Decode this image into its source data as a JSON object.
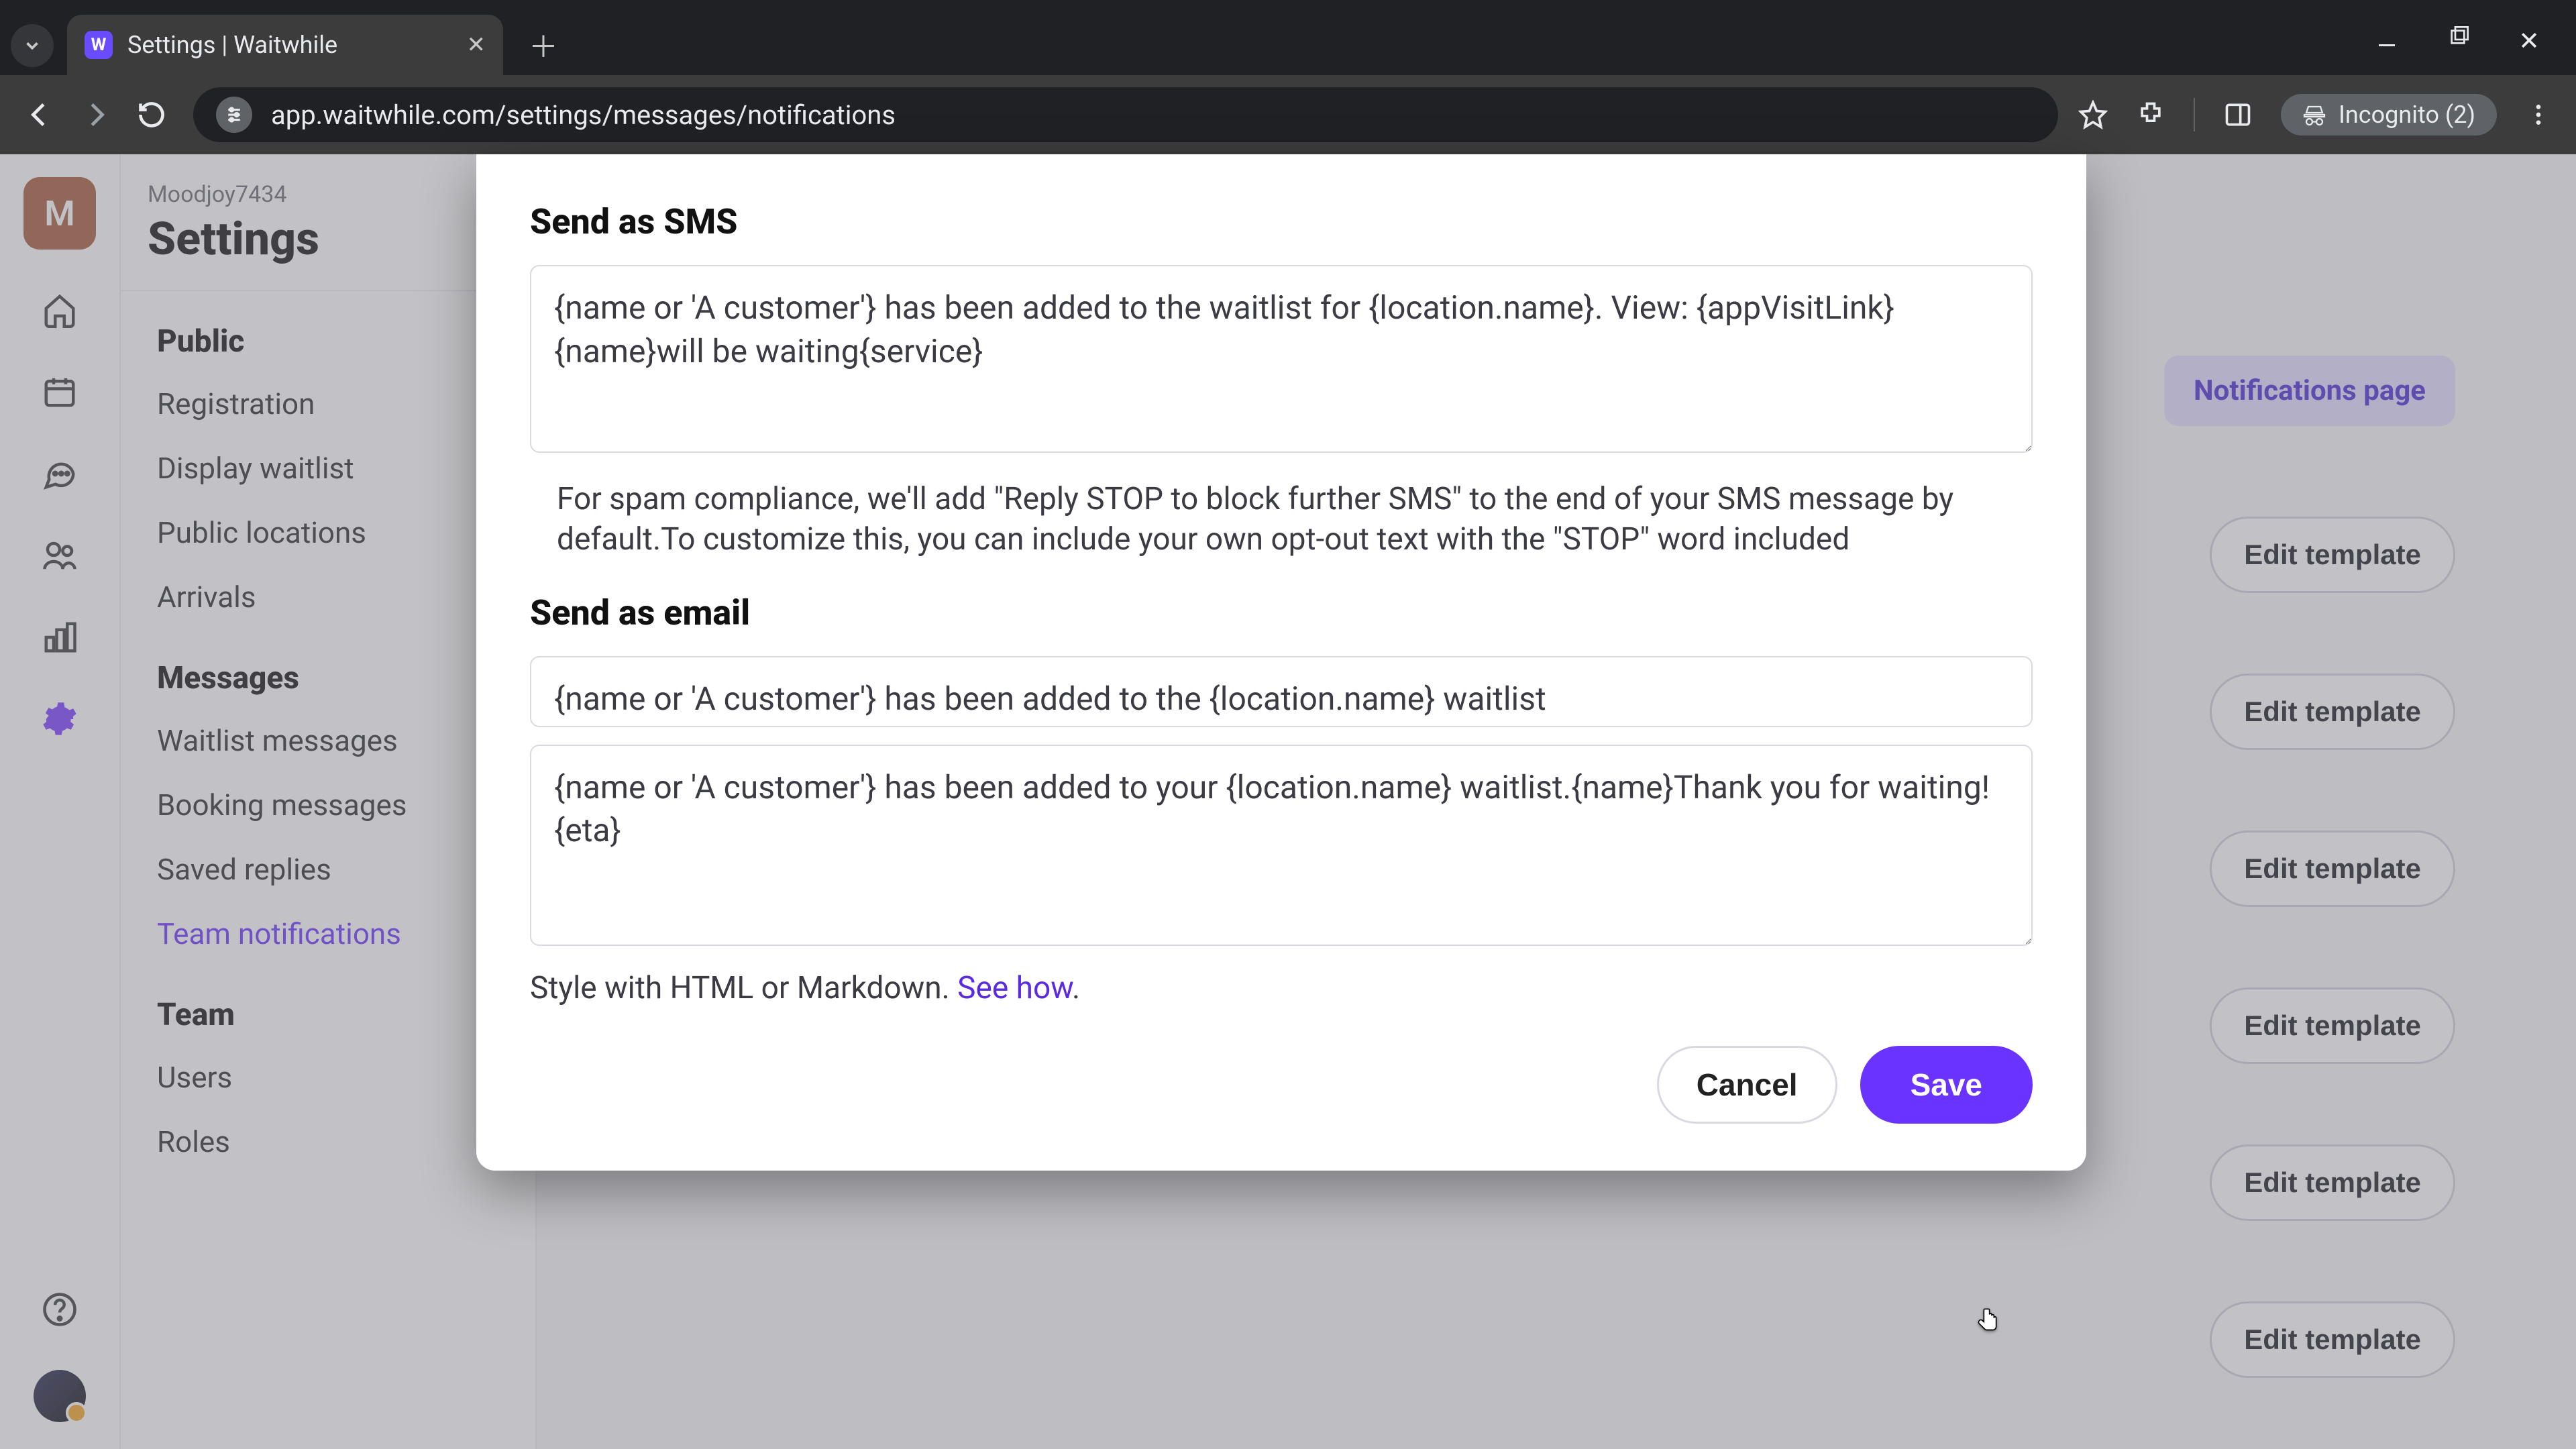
{
  "browser": {
    "tab_title": "Settings | Waitwhile",
    "url": "app.waitwhile.com/settings/messages/notifications",
    "incognito_label": "Incognito (2)"
  },
  "iconbar": {
    "org_initial": "M"
  },
  "settings": {
    "org_name": "Moodjoy7434",
    "title": "Settings",
    "groups": {
      "public": {
        "title": "Public",
        "items": [
          "Registration",
          "Display waitlist",
          "Public locations",
          "Arrivals"
        ]
      },
      "messages": {
        "title": "Messages",
        "items": [
          "Waitlist messages",
          "Booking messages",
          "Saved replies",
          "Team notifications"
        ]
      },
      "team": {
        "title": "Team",
        "items": [
          "Users",
          "Roles"
        ]
      }
    },
    "active_item": "Team notifications"
  },
  "main": {
    "notifications_pill": "Notifications page",
    "edit_template_label": "Edit template"
  },
  "modal": {
    "sms_heading": "Send as SMS",
    "sms_value": "{name or 'A customer'} has been added to the waitlist for {location.name}. View: {appVisitLink}{name}will be waiting{service}",
    "sms_helper": "For spam compliance, we'll add \"Reply STOP to block further SMS\" to the end of your SMS message by default.To customize this, you can include your own opt-out text with the \"STOP\" word included",
    "email_heading": "Send as email",
    "email_subject_value": "{name or 'A customer'} has been added to the {location.name} waitlist",
    "email_body_value": "{name or 'A customer'} has been added to your {location.name} waitlist.{name}Thank you for waiting! {eta}",
    "style_helper_prefix": "Style with HTML or Markdown. ",
    "style_helper_link": "See how",
    "style_helper_suffix": ".",
    "cancel_label": "Cancel",
    "save_label": "Save"
  }
}
